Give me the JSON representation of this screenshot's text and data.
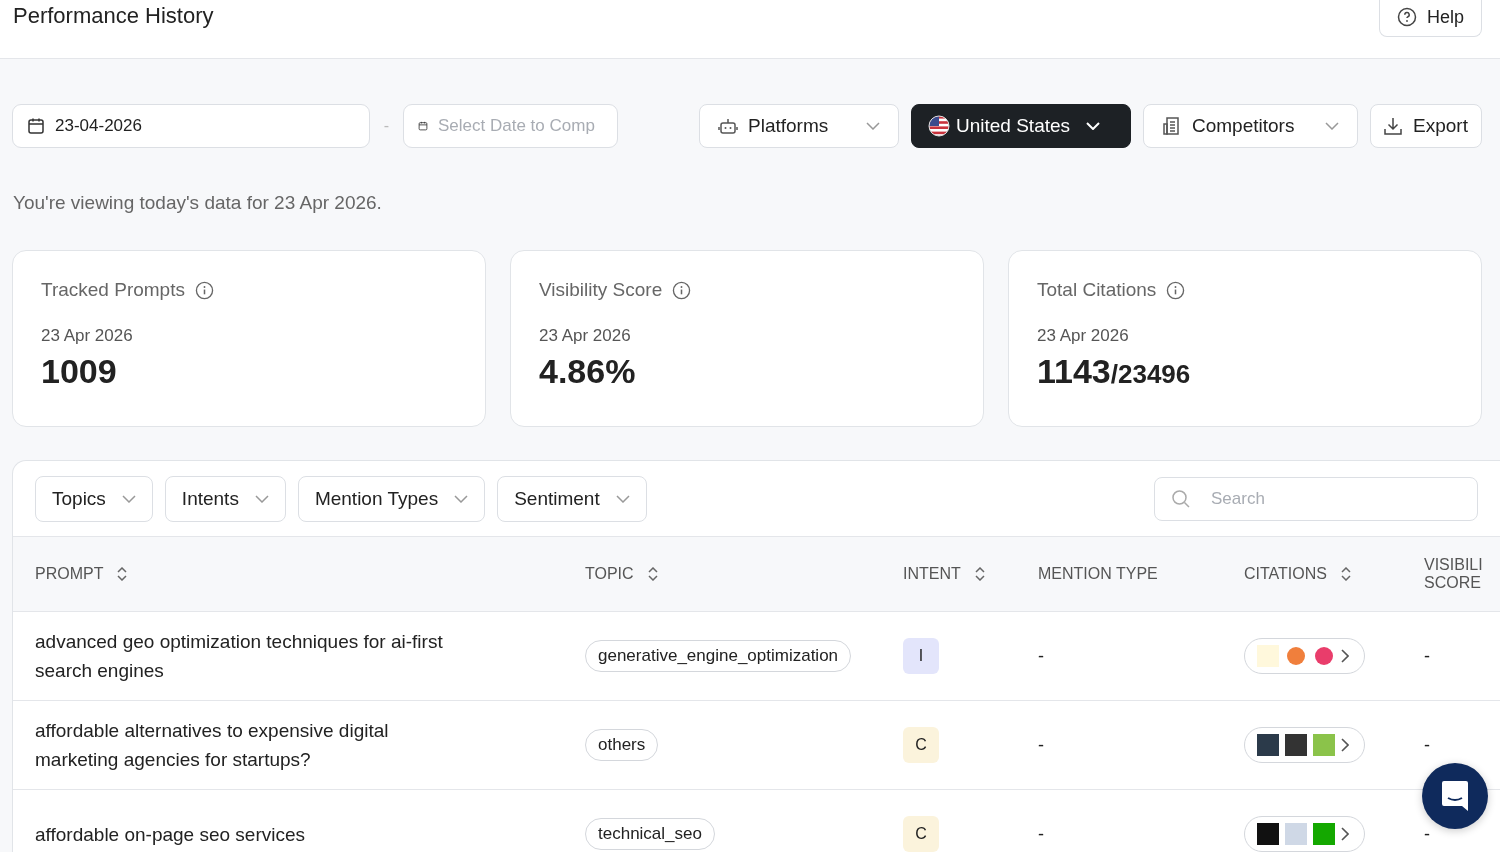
{
  "header": {
    "title": "Performance History",
    "help": "Help"
  },
  "toolbar": {
    "date": "23-04-2026",
    "separator": "-",
    "compare_placeholder": "Select Date to Comp",
    "platforms": "Platforms",
    "country": "United States",
    "competitors": "Competitors",
    "export": "Export"
  },
  "notice": "You're viewing today's data for 23 Apr 2026.",
  "stats": [
    {
      "label": "Tracked Prompts",
      "date": "23 Apr 2026",
      "value": "1009"
    },
    {
      "label": "Visibility Score",
      "date": "23 Apr 2026",
      "value": "4.86%"
    },
    {
      "label": "Total Citations",
      "date": "23 Apr 2026",
      "value": "1143",
      "total": "/23496"
    }
  ],
  "filters": [
    "Topics",
    "Intents",
    "Mention Types",
    "Sentiment"
  ],
  "search": {
    "placeholder": "Search"
  },
  "table": {
    "columns": [
      {
        "label": "PROMPT",
        "sortable": true
      },
      {
        "label": "TOPIC",
        "sortable": true
      },
      {
        "label": "INTENT",
        "sortable": true
      },
      {
        "label": "MENTION TYPE",
        "sortable": false
      },
      {
        "label": "CITATIONS",
        "sortable": true
      },
      {
        "label": "VISIBILI SCORE",
        "sortable": false
      }
    ],
    "rows": [
      {
        "prompt": "advanced geo optimization techniques for ai-first search engines",
        "topic": "generative_engine_optimization",
        "intent": {
          "label": "I",
          "color": "#e3e5fb"
        },
        "mention_type": "-",
        "sources": [
          {
            "color": "#fff8dc"
          },
          {
            "color": "#f07f3c"
          },
          {
            "color": "#e93d6b"
          }
        ],
        "visibility": "-"
      },
      {
        "prompt": "affordable alternatives to expensive digital marketing agencies for startups?",
        "topic": "others",
        "intent": {
          "label": "C",
          "color": "#fbf3dc"
        },
        "mention_type": "-",
        "sources": [
          {
            "color": "#2b3a4a"
          },
          {
            "color": "#333333"
          },
          {
            "color": "#8bc34a"
          }
        ],
        "visibility": "-"
      },
      {
        "prompt": "affordable on-page seo services",
        "topic": "technical_seo",
        "intent": {
          "label": "C",
          "color": "#fbf3dc"
        },
        "mention_type": "-",
        "sources": [
          {
            "color": "#111111"
          },
          {
            "color": "#cfd8e6"
          },
          {
            "color": "#14a800"
          }
        ],
        "visibility": "-"
      }
    ]
  }
}
